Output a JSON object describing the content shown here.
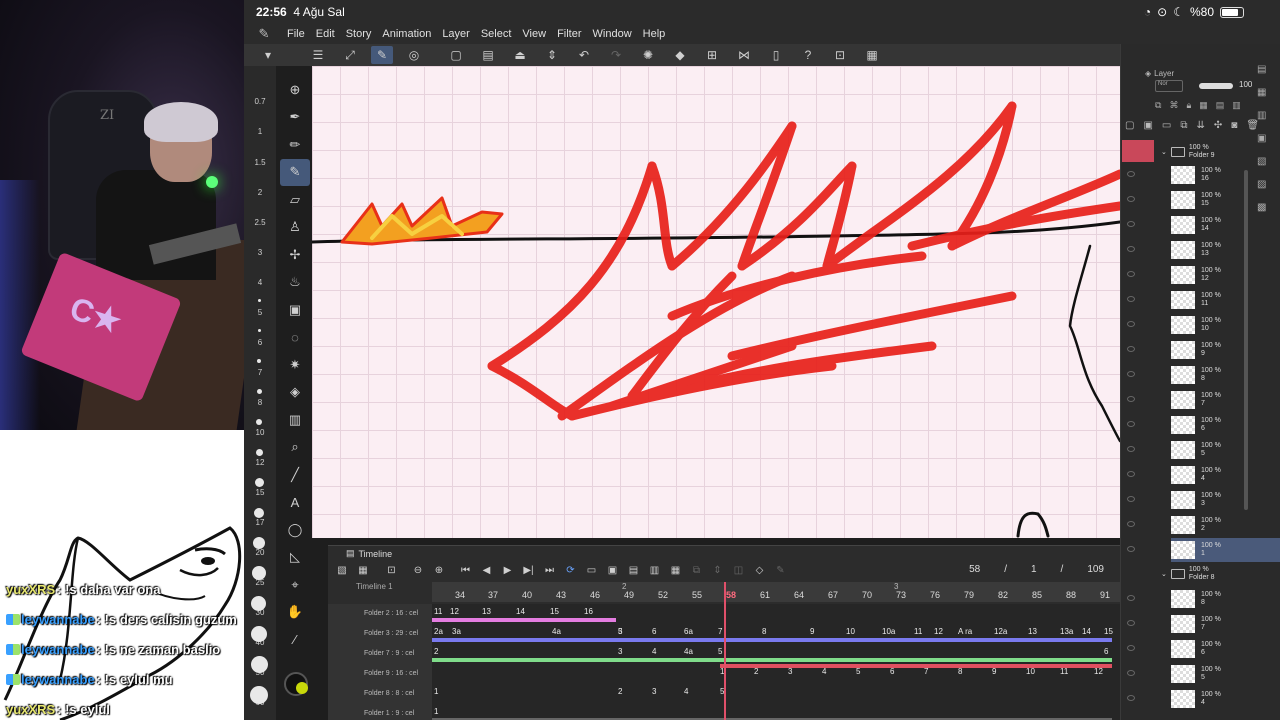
{
  "status": {
    "time": "22:56",
    "date": "4 Ağu Sal",
    "battery": "%80",
    "battery_fraction": 0.8
  },
  "menubar": [
    "File",
    "Edit",
    "Story",
    "Animation",
    "Layer",
    "Select",
    "View",
    "Filter",
    "Window",
    "Help"
  ],
  "ruler_ticks": [
    "0.7",
    "1",
    "1.5",
    "2",
    "2.5",
    "3",
    "4",
    "5",
    "6",
    "7",
    "8",
    "10",
    "12",
    "15",
    "17",
    "20",
    "25",
    "30",
    "40",
    "50",
    "60"
  ],
  "chat": [
    {
      "user": "yuxXRS",
      "badge": false,
      "message": "!s daha var ona"
    },
    {
      "user": "leywannabe",
      "badge": true,
      "message": "!s ders calisin guzum"
    },
    {
      "user": "leywannabe",
      "badge": true,
      "message": "!s ne zaman baslio"
    },
    {
      "user": "leywannabe",
      "badge": true,
      "message": "!s eylul mu"
    },
    {
      "user": "yuxXRS",
      "badge": false,
      "message": "!s eylul"
    }
  ],
  "webcam": {
    "chair_text": "ZI"
  },
  "timeline": {
    "tab_label": "Timeline",
    "name_label": "Timeline 1",
    "current_frame": "58",
    "position": "1",
    "total_frames": "109",
    "frame_numbers": [
      "34",
      "37",
      "40",
      "43",
      "46",
      "49",
      "52",
      "55",
      "58",
      "61",
      "64",
      "67",
      "70",
      "73",
      "76",
      "79",
      "82",
      "85",
      "88",
      "91"
    ],
    "sub_marks": [
      "2",
      "3"
    ],
    "tracks": [
      {
        "name": "Folder 2 : 16 : cel",
        "color": "#c255b5",
        "bar_color": "#e47de0",
        "cels": [
          "11",
          "12",
          "13",
          "14",
          "15",
          "16"
        ]
      },
      {
        "name": "Folder 3 : 29 : cel",
        "color": "#5a5ad0",
        "bar_color": "#7a7aee",
        "cels": [
          "2a",
          "3",
          "3a",
          "4a",
          "5",
          "6",
          "6a",
          "7",
          "8",
          "9",
          "10",
          "10a",
          "11",
          "12",
          "A ra",
          "12a",
          "13",
          "13a",
          "14",
          "15"
        ]
      },
      {
        "name": "Folder 7 : 9 : cel",
        "color": "#4aa55a",
        "bar_color": "#7fdc8a",
        "cels": [
          "2",
          "3",
          "4",
          "4a",
          "5",
          "6"
        ]
      },
      {
        "name": "Folder 9 : 16 : cel",
        "color": "#c0404d",
        "bar_color": "#e05060",
        "cels": [
          "1",
          "2",
          "3",
          "4",
          "5",
          "6",
          "7",
          "8",
          "9",
          "10",
          "11",
          "12"
        ]
      },
      {
        "name": "Folder 8 : 8 : cel",
        "color": "#444444",
        "bar_color": "#555555",
        "cels": [
          "1",
          "2",
          "3",
          "4",
          "5"
        ]
      },
      {
        "name": "Folder 1 : 9 : cel",
        "color": "#444444",
        "bar_color": "#666666",
        "cels": [
          "1"
        ]
      }
    ]
  },
  "layers": {
    "panel_tab": "Layer",
    "opacity": "100",
    "folder_a": {
      "name": "Folder 9",
      "opacity": "100 %"
    },
    "folder_b": {
      "name": "Folder 8",
      "opacity": "100 %"
    },
    "rows_a": [
      {
        "opacity": "100 %",
        "name": "16"
      },
      {
        "opacity": "100 %",
        "name": "15"
      },
      {
        "opacity": "100 %",
        "name": "14"
      },
      {
        "opacity": "100 %",
        "name": "13"
      },
      {
        "opacity": "100 %",
        "name": "12"
      },
      {
        "opacity": "100 %",
        "name": "11"
      },
      {
        "opacity": "100 %",
        "name": "10"
      },
      {
        "opacity": "100 %",
        "name": "9"
      },
      {
        "opacity": "100 %",
        "name": "8"
      },
      {
        "opacity": "100 %",
        "name": "7"
      },
      {
        "opacity": "100 %",
        "name": "6"
      },
      {
        "opacity": "100 %",
        "name": "5"
      },
      {
        "opacity": "100 %",
        "name": "4"
      },
      {
        "opacity": "100 %",
        "name": "3"
      },
      {
        "opacity": "100 %",
        "name": "2"
      },
      {
        "opacity": "100 %",
        "name": "1"
      }
    ],
    "rows_b": [
      {
        "opacity": "100 %",
        "name": "8"
      },
      {
        "opacity": "100 %",
        "name": "7"
      },
      {
        "opacity": "100 %",
        "name": "6"
      },
      {
        "opacity": "100 %",
        "name": "5"
      },
      {
        "opacity": "100 %",
        "name": "4"
      }
    ]
  },
  "colors": {
    "accent": "#45597a",
    "brush_red": "#e8201a",
    "flame_orange": "#f5a020",
    "canvas": "#fbeef3"
  }
}
